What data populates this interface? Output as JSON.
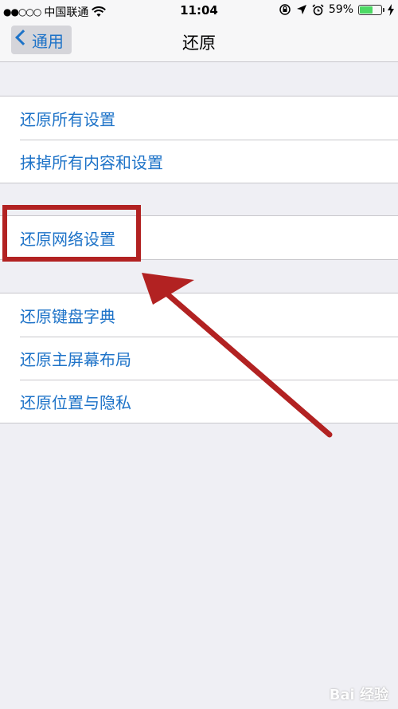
{
  "status_bar": {
    "signal": "●●○○○",
    "carrier": "中国联通",
    "time": "11:04",
    "battery_percent": "59%",
    "battery_level": 0.59
  },
  "navbar": {
    "back_label": "通用",
    "title": "还原"
  },
  "groups": [
    {
      "items": [
        "还原所有设置",
        "抹掉所有内容和设置"
      ]
    },
    {
      "items": [
        "还原网络设置"
      ]
    },
    {
      "items": [
        "还原键盘字典",
        "还原主屏幕布局",
        "还原位置与隐私"
      ]
    }
  ],
  "annotation": {
    "color": "#b22222"
  },
  "watermark": "Bai 经验",
  "colors": {
    "link": "#1e73c8",
    "background": "#efeff4",
    "battery": "#4cd964"
  }
}
